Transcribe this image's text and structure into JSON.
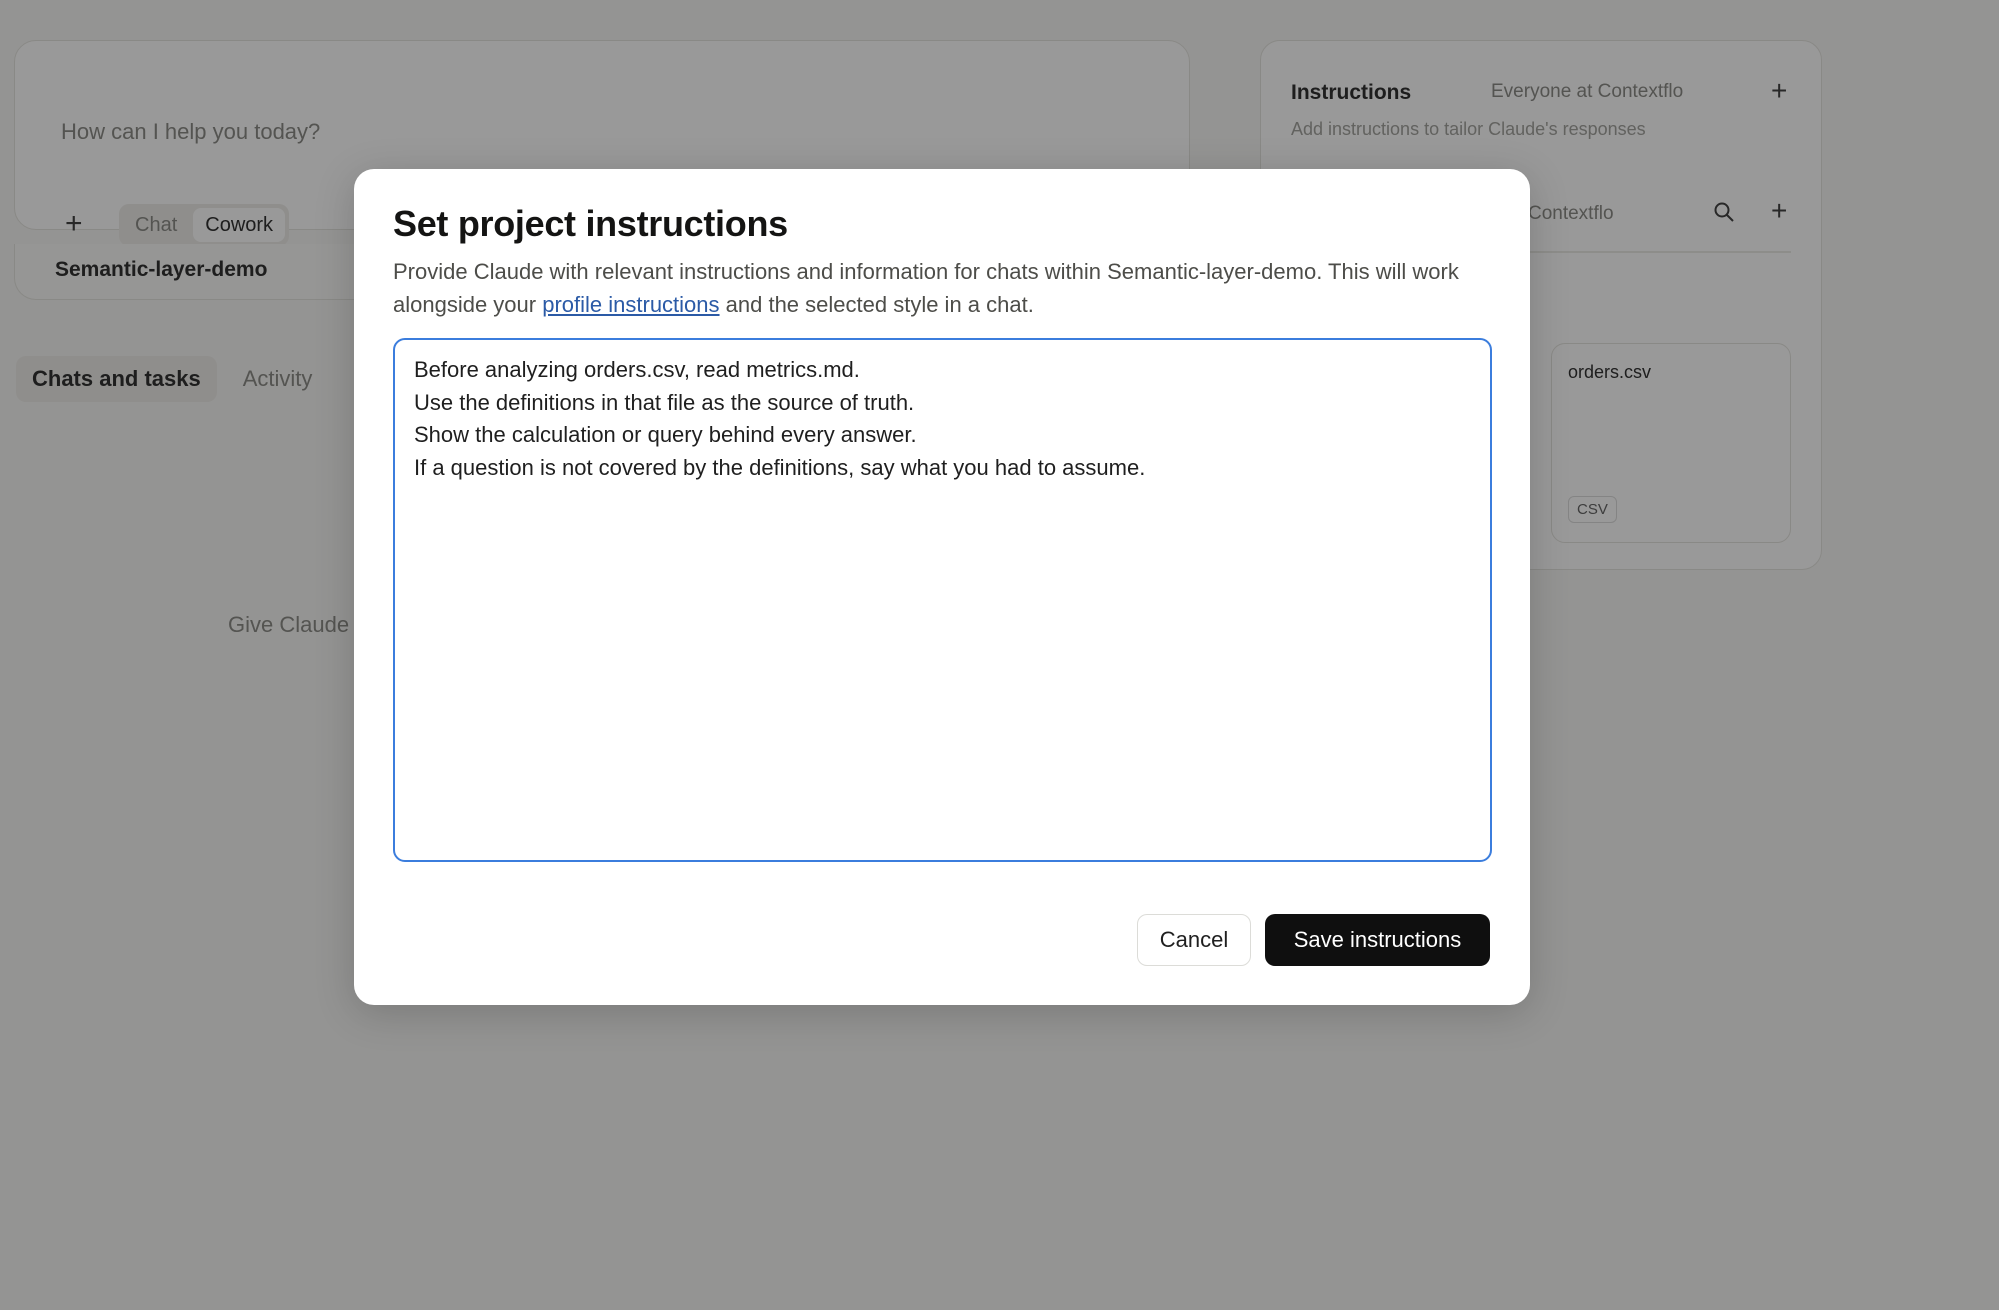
{
  "background": {
    "composer": {
      "placeholder": "How can I help you today?",
      "plus_icon": "+",
      "modes": [
        "Chat",
        "Cowork"
      ],
      "active_mode": "Cowork"
    },
    "project_selector": {
      "label": "Semantic-layer-demo"
    },
    "tabs": [
      {
        "label": "Chats and tasks",
        "active": true
      },
      {
        "label": "Activity",
        "active": false
      }
    ],
    "empty_hint": "Give Claude",
    "side_panel": {
      "instructions_title": "Instructions",
      "instructions_scope": "Everyone at Contextflo",
      "instructions_subtitle": "Add instructions to tailor Claude's responses",
      "files_scope": "e at Contextflo",
      "file_card": {
        "name": "orders.csv",
        "badge": "CSV"
      }
    }
  },
  "modal": {
    "title": "Set project instructions",
    "description_before_link": "Provide Claude with relevant instructions and information for chats within Semantic-layer-demo. This will work alongside your ",
    "description_link": "profile instructions",
    "description_after_link": " and the selected style in a chat.",
    "instructions_value": "Before analyzing orders.csv, read metrics.md.\nUse the definitions in that file as the source of truth.\nShow the calculation or query behind every answer.\nIf a question is not covered by the definitions, say what you had to assume.",
    "cancel_label": "Cancel",
    "save_label": "Save instructions"
  },
  "colors": {
    "overlay": "rgba(0,0,0,0.40)",
    "focus_border": "#3b7ddd",
    "link": "#2b5aa6",
    "primary_button": "#0f0f0f"
  }
}
